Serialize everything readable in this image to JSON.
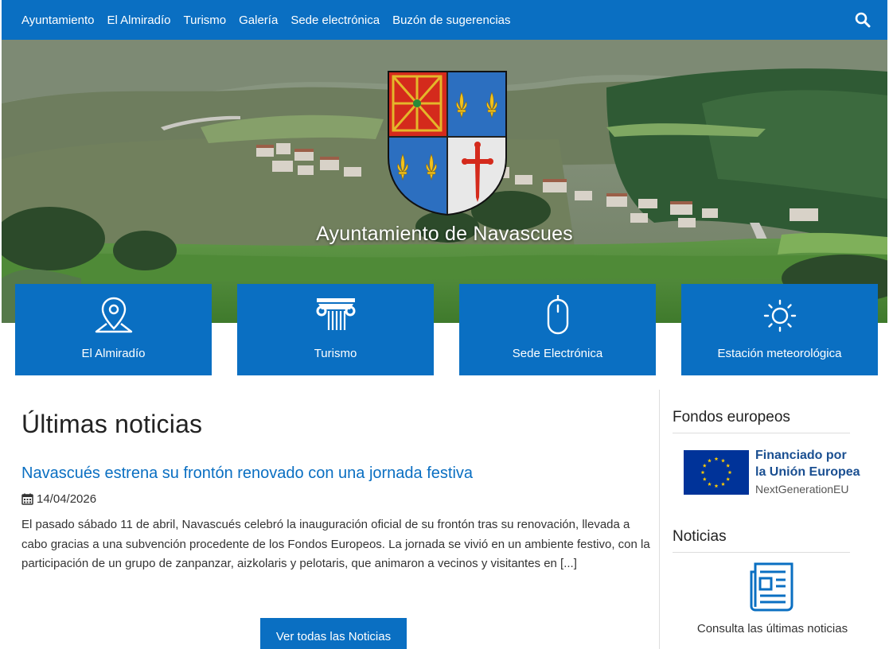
{
  "nav": {
    "items": [
      "Ayuntamiento",
      "El Almiradío",
      "Turismo",
      "Galería",
      "Sede electrónica",
      "Buzón de sugerencias"
    ],
    "search_icon": "search-icon"
  },
  "hero": {
    "title": "Ayuntamiento de Navascues",
    "crest_icon": "coat-of-arms"
  },
  "tiles": [
    {
      "label": "El Almiradío",
      "icon": "map-pin-icon"
    },
    {
      "label": "Turismo",
      "icon": "column-icon"
    },
    {
      "label": "Sede Electrónica",
      "icon": "mouse-icon"
    },
    {
      "label": "Estación meteorológica",
      "icon": "sun-icon"
    }
  ],
  "main": {
    "heading": "Últimas noticias",
    "news": {
      "title": "Navascués estrena su frontón renovado con una jornada festiva",
      "date": "14/04/2026",
      "excerpt": "El pasado sábado 11 de abril, Navascués celebró la inauguración oficial de su frontón tras su renovación, llevada a cabo gracias a una subvención procedente de los Fondos Europeos. La jornada se vivió en un ambiente festivo, con la participación de un grupo de zanpanzar, aizkolaris y pelotaris, que animaron a vecinos y visitantes en [...]"
    },
    "all_news_button": "Ver todas las Noticias"
  },
  "sidebar": {
    "funds_heading": "Fondos europeos",
    "eu_line1": "Financiado por",
    "eu_line2": "la Unión Europea",
    "eu_line3": "NextGenerationEU",
    "news_heading": "Noticias",
    "news_link": "Consulta las últimas noticias"
  },
  "colors": {
    "primary": "#0a6fc2",
    "eu_blue": "#003399",
    "eu_star": "#ffcc00"
  }
}
